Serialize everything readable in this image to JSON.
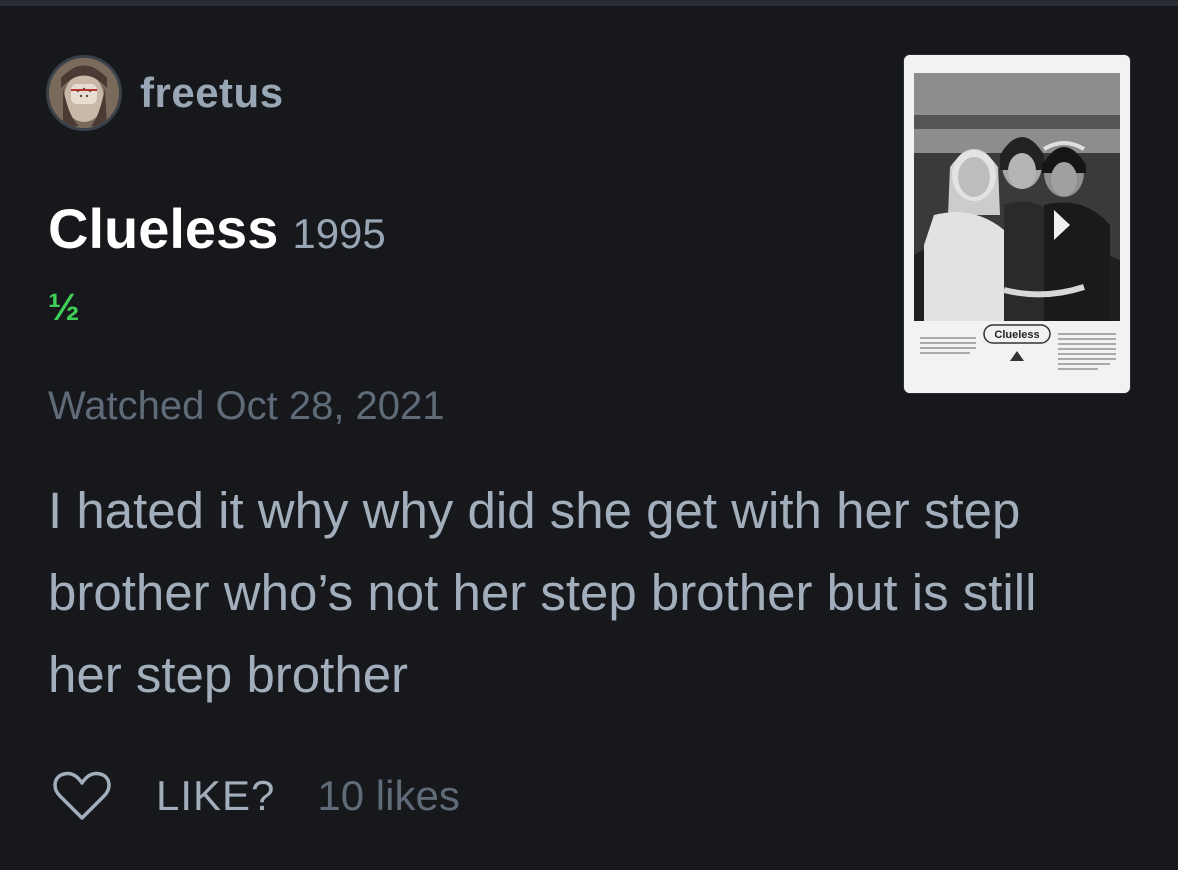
{
  "review": {
    "author": {
      "username": "freetus",
      "avatar_icon": "user-avatar"
    },
    "film": {
      "title": "Clueless",
      "year": "1995",
      "poster_wordmark": "Clueless"
    },
    "rating": "½",
    "rating_value": 0.5,
    "rating_color": "#3fcf56",
    "watched_text": "Watched Oct 28, 2021",
    "body": "I hated it why why did she get with her step brother who’s not her step brother but is still her step brother",
    "actions": {
      "heart_icon": "heart-outline-icon",
      "like_label": "LIKE?",
      "like_count": "10 likes"
    }
  },
  "colors": {
    "background": "#16181c",
    "title": "#ffffff",
    "muted": "#5f6b78",
    "body": "#a2aebc",
    "accent_green": "#3fcf56"
  }
}
